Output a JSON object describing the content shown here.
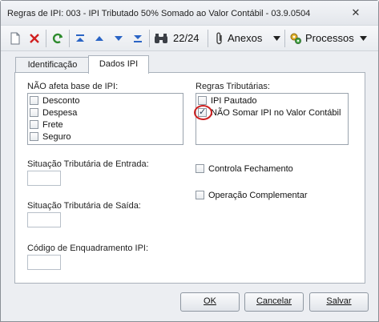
{
  "window": {
    "title": "Regras de IPI: 003 - IPI Tributado 50% Somado ao Valor Contábil - 03.9.0504",
    "close_glyph": "✕"
  },
  "toolbar": {
    "record_position": "22/24",
    "anexos_label": "Anexos",
    "processos_label": "Processos"
  },
  "tabs": [
    {
      "label": "Identificação"
    },
    {
      "label": "Dados IPI"
    }
  ],
  "nao_afeta": {
    "label": "NÃO afeta base de IPI:",
    "items": [
      {
        "label": "Desconto",
        "checked": false
      },
      {
        "label": "Despesa",
        "checked": false
      },
      {
        "label": "Frete",
        "checked": false
      },
      {
        "label": "Seguro",
        "checked": false
      }
    ]
  },
  "regras": {
    "label": "Regras Tributárias:",
    "items": [
      {
        "label": "IPI Pautado",
        "checked": false
      },
      {
        "label": "NÃO Somar IPI no Valor Contábil",
        "checked": true
      }
    ]
  },
  "fields": {
    "entrada_label": "Situação Tributária de Entrada:",
    "saida_label": "Situação Tributária de Saída:",
    "enquadramento_label": "Código de Enquadramento IPI:"
  },
  "options": {
    "controla_label": "Controla Fechamento",
    "operacao_label": "Operação Complementar"
  },
  "buttons": {
    "ok_label": "OK",
    "cancelar_label": "Cancelar",
    "salvar_label": "Salvar"
  },
  "colors": {
    "highlight_circle": "#cc2222",
    "refresh_green": "#2e8b2e",
    "close_red": "#d02020",
    "arrow_blue": "#2a64c5"
  }
}
